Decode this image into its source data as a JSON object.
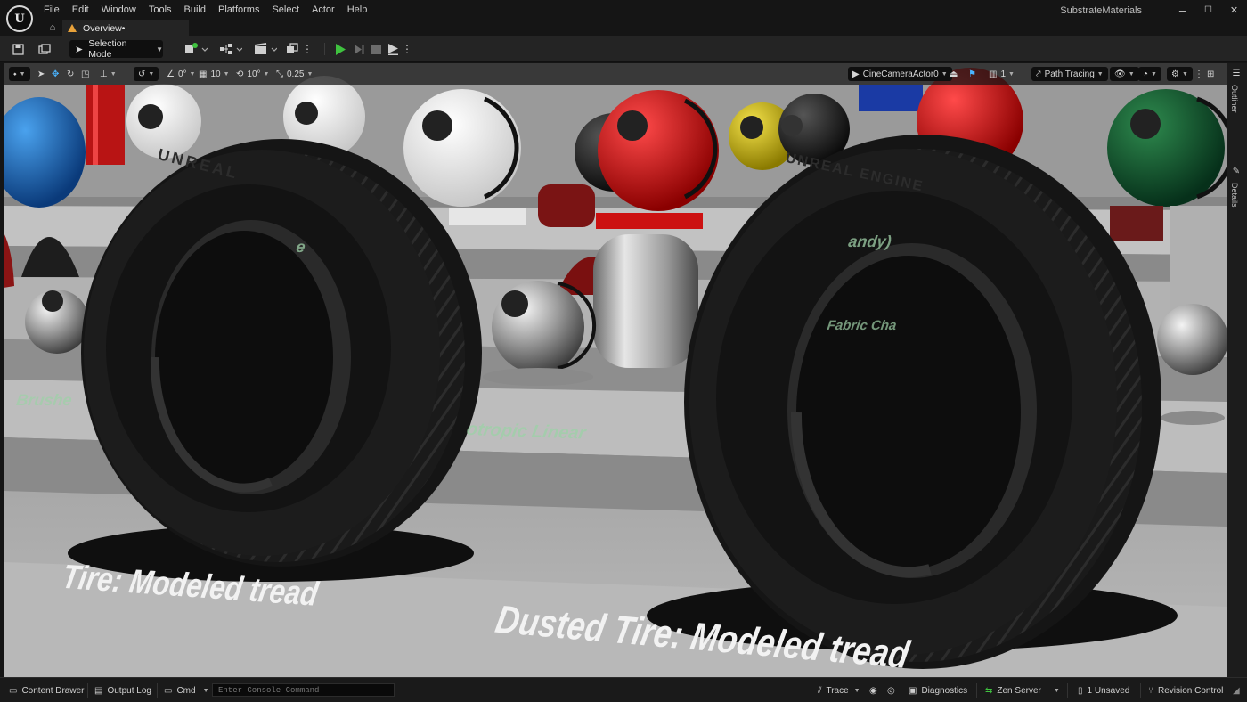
{
  "app": {
    "project_name": "SubstrateMaterials",
    "menu": [
      "File",
      "Edit",
      "Window",
      "Tools",
      "Build",
      "Platforms",
      "Select",
      "Actor",
      "Help"
    ],
    "window_controls": {
      "minimize": "–",
      "maximize": "☐",
      "close": "✕"
    }
  },
  "tabs": {
    "active_tab": "Overview•"
  },
  "toolbar": {
    "mode_label": "Selection Mode",
    "play_color": "#3fc23f"
  },
  "viewport_toolbar": {
    "rotate_snap": "0°",
    "grid_snap": "10",
    "angle_snap": "10°",
    "scale_snap": "0.25",
    "camera": "CineCameraActor0",
    "layout_count": "1",
    "view_mode": "Path Tracing"
  },
  "scene": {
    "label_left": "Tire: Modeled tread",
    "label_right": "Dusted Tire: Modeled tread",
    "label_bg_brushed": "Brushe",
    "label_bg_anisotropic": "otropic Linear",
    "label_bg_fabric": "Fabric Cha",
    "label_bg_candy": "andy)",
    "label_bg_e": "e",
    "tire_brand_left": "UNREAL",
    "tire_brand_right": "UNREAL ENGINE"
  },
  "side_panels": {
    "outliner": "Outliner",
    "details": "Details"
  },
  "statusbar": {
    "content_drawer": "Content Drawer",
    "output_log": "Output Log",
    "cmd": "Cmd",
    "console_placeholder": "Enter Console Command",
    "trace": "Trace",
    "diagnostics": "Diagnostics",
    "zen_server": "Zen Server",
    "unsaved": "1 Unsaved",
    "revision_control": "Revision Control"
  }
}
